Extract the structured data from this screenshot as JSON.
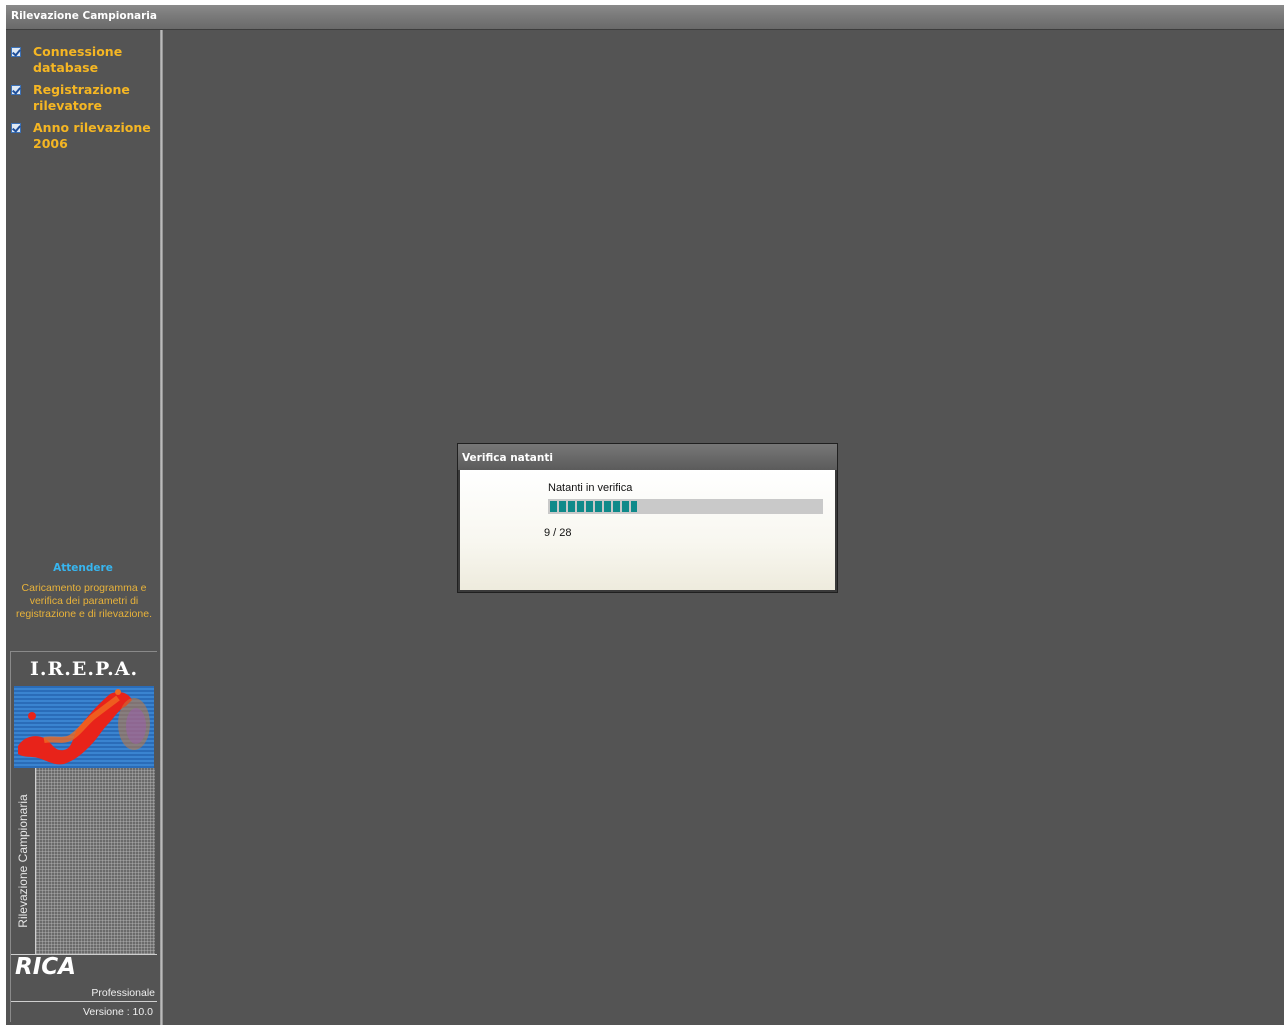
{
  "window": {
    "title": "Rilevazione Campionaria"
  },
  "sidebar": {
    "steps": [
      {
        "label_line1": "Connessione",
        "label_line2": "database",
        "checked": true
      },
      {
        "label_line1": "Registrazione",
        "label_line2": "rilevatore",
        "checked": true
      },
      {
        "label_line1": "Anno rilevazione",
        "label_line2": "2006",
        "checked": true
      }
    ],
    "wait_title": "Attendere",
    "wait_message": "Caricamento programma e verifica dei parametri di registrazione e di rilevazione."
  },
  "logo": {
    "org": "I.R.E.P.A.",
    "vertical_text": "Rilevazione Campionaria",
    "product": "RICA",
    "edition": "Professionale",
    "version": "Versione : 10.0"
  },
  "dialog": {
    "title": "Verifica natanti",
    "progress_label": "Natanti in verifica",
    "progress_count": "9 / 28",
    "progress_value": 9,
    "progress_total": 28,
    "progress_color": "#0f8a8a"
  },
  "colors": {
    "background": "#545454",
    "step_label": "#f5b623",
    "wait_title": "#37b6f0",
    "wait_message": "#e9b33a"
  }
}
